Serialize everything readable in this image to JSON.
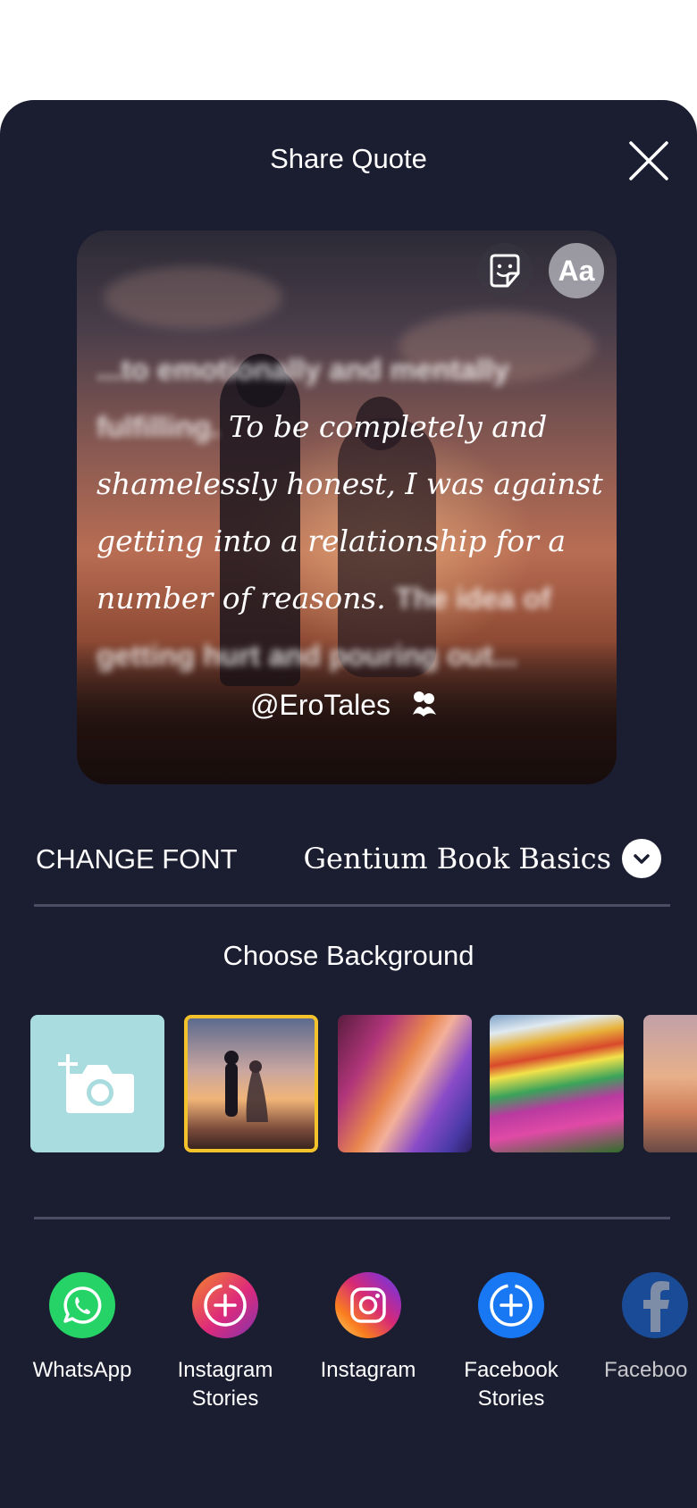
{
  "header": {
    "title": "Share Quote"
  },
  "card": {
    "quote_blur_before": "...to emotionally and mentally fulfilling.",
    "quote_main": "To be completely and shamelessly honest, I was against getting into a relationship for a number of reasons.",
    "quote_blur_after": "The idea of getting hurt and pouring out...",
    "handle": "@EroTales",
    "font_button_label": "Aa"
  },
  "font": {
    "label": "CHANGE FONT",
    "value": "Gentium Book Basics"
  },
  "backgrounds": {
    "title": "Choose Background",
    "selected_index": 1
  },
  "share_targets": [
    {
      "label_line1": "WhatsApp",
      "label_line2": ""
    },
    {
      "label_line1": "Instagram",
      "label_line2": "Stories"
    },
    {
      "label_line1": "Instagram",
      "label_line2": ""
    },
    {
      "label_line1": "Facebook",
      "label_line2": "Stories"
    },
    {
      "label_line1": "Faceboo",
      "label_line2": ""
    }
  ],
  "colors": {
    "sheet_bg": "#1b1d30",
    "selected_border": "#f4c22b",
    "whatsapp": "#25d366",
    "facebook": "#1877f2"
  }
}
